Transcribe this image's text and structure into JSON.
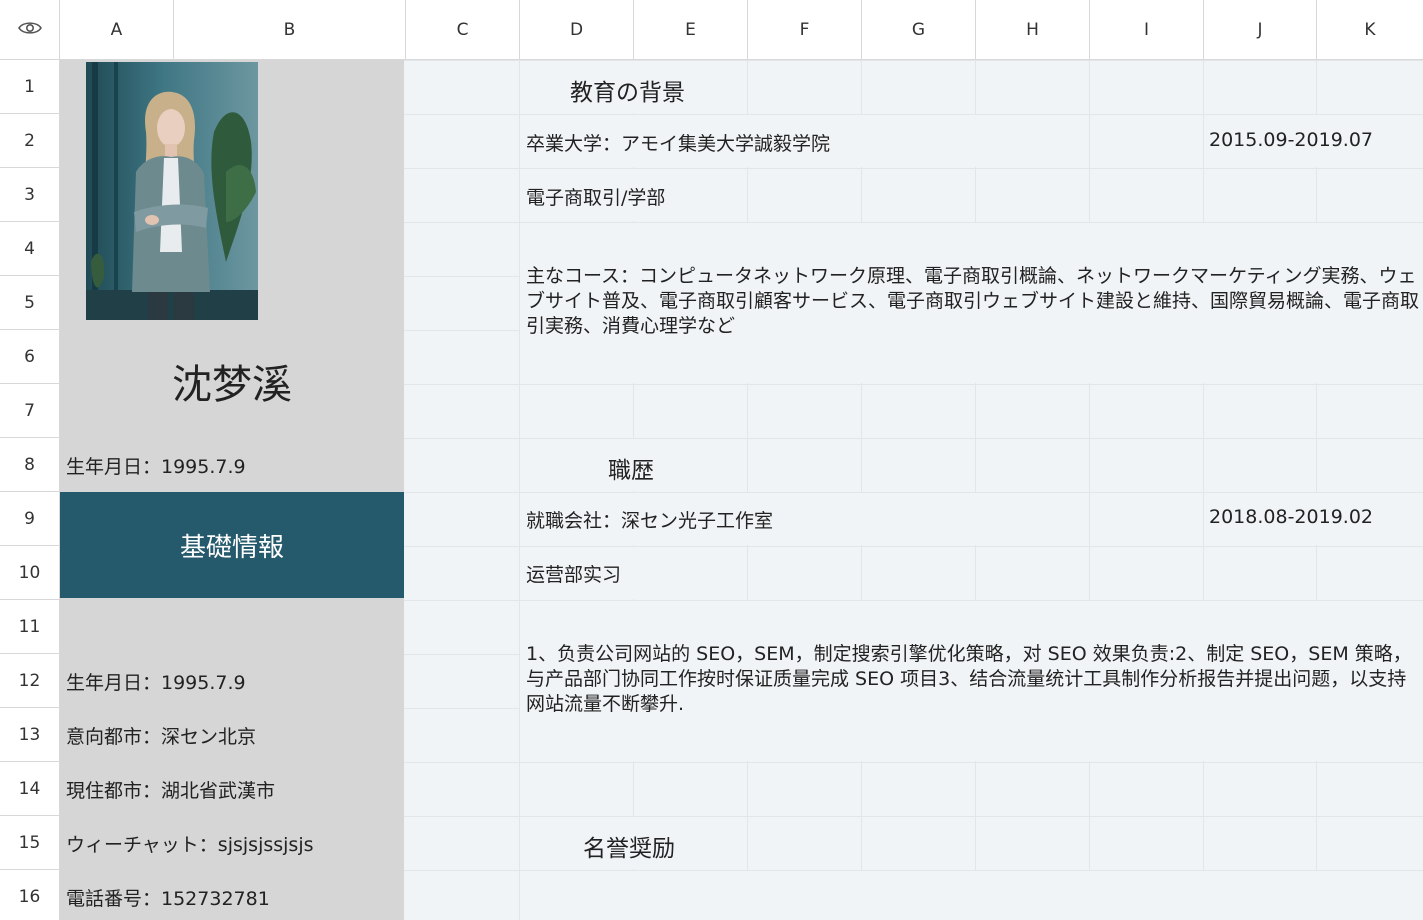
{
  "columns": [
    "A",
    "B",
    "C",
    "D",
    "E",
    "F",
    "G",
    "H",
    "I",
    "J",
    "K"
  ],
  "rows": [
    "1",
    "2",
    "3",
    "4",
    "5",
    "6",
    "7",
    "8",
    "9",
    "10",
    "11",
    "12",
    "13",
    "14",
    "15",
    "16"
  ],
  "profile": {
    "name": "沈梦溪",
    "birth_top": "生年月日：1995.7.9",
    "section_title": "基礎情報",
    "birth": "生年月日：1995.7.9",
    "preferred_city": "意向都市：深セン北京",
    "current_city": "現住都市：湖北省武漢市",
    "wechat": "ウィーチャット：sjsjsjssjsjs",
    "phone": "電話番号：152732781"
  },
  "education": {
    "heading": "教育の背景",
    "university": "卒業大学：アモイ集美大学誠毅学院",
    "period": "2015.09-2019.07",
    "major": "電子商取引/学部",
    "courses": "主なコース：コンピュータネットワーク原理、電子商取引概論、ネットワークマーケティング実務、ウェブサイト普及、電子商取引顧客サービス、電子商取引ウェブサイト建設と維持、国際貿易概論、電子商取引実務、消費心理学など"
  },
  "career": {
    "heading": "職歴",
    "company": "就職会社：深セン光子工作室",
    "period": "2018.08-2019.02",
    "position": "运营部实习",
    "description": "1、负责公司网站的 SEO，SEM，制定搜索引擎优化策略，对 SEO 效果负责:2、制定 SEO，SEM 策略，与产品部门协同工作按时保证质量完成 SEO 项目3、结合流量统计工具制作分析报告并提出问题，以支持网站流量不断攀升."
  },
  "honors": {
    "heading": "名誉奨励"
  },
  "colors": {
    "panel": "#d6d6d6",
    "accent": "#255a6c",
    "grid_bg": "#f1f4f6"
  }
}
